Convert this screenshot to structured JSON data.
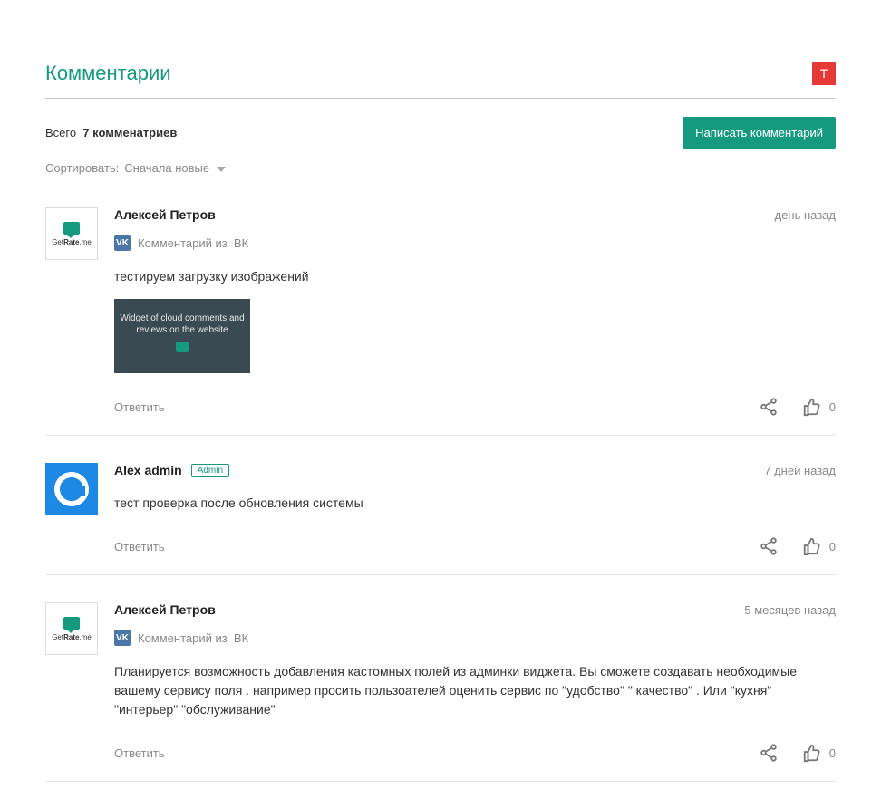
{
  "header": {
    "title": "Комментарии",
    "badge": "T"
  },
  "meta": {
    "total_label": "Всего",
    "total_count": "7 комменатриев",
    "write_button": "Написать комментарий",
    "sort_label": "Сортировать:",
    "sort_value": "Сначала новые"
  },
  "labels": {
    "reply": "Ответить",
    "source_prefix": "Комментарий из",
    "source_vk": "ВК",
    "admin_badge": "Admin",
    "avatar_brand_1": "Get",
    "avatar_brand_2": "Rate",
    "avatar_brand_3": ".me"
  },
  "attachment": {
    "title": "Widget of cloud comments and reviews on the website"
  },
  "comments": [
    {
      "author": "Алексей Петров",
      "timestamp": "день назад",
      "source": "vk",
      "admin": false,
      "avatar_type": "getrate",
      "text": "тестируем загрузку изображений",
      "has_attachment": true,
      "likes": "0"
    },
    {
      "author": "Alex admin",
      "timestamp": "7 дней назад",
      "source": null,
      "admin": true,
      "avatar_type": "circle",
      "text": "тест проверка после обновления системы",
      "has_attachment": false,
      "likes": "0"
    },
    {
      "author": "Алексей Петров",
      "timestamp": "5 месяцев назад",
      "source": "vk",
      "admin": false,
      "avatar_type": "getrate",
      "text": "Планируется возможность добавления кастомных полей из админки виджета. Вы сможете создавать необходимые вашему сервису поля . например просить пользоателей оценить сервис по \"удобство\" \" качество\" . Или \"кухня\" \"интерьер\" \"обслуживание\"",
      "has_attachment": false,
      "likes": "0"
    }
  ]
}
